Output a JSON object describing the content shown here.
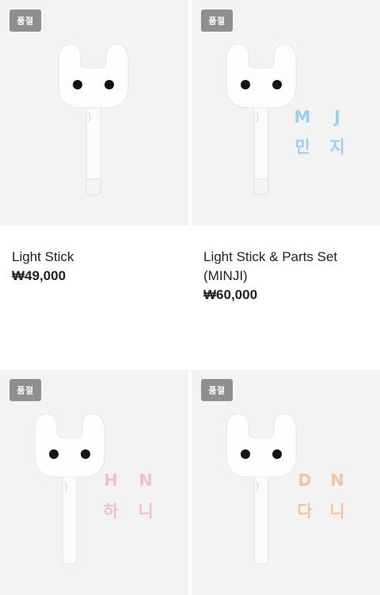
{
  "products": [
    {
      "badge": "품절",
      "name": "Light Stick",
      "price": "₩49,000"
    },
    {
      "badge": "품절",
      "name": "Light Stick & Parts Set (MINJI)",
      "price": "₩60,000",
      "parts": [
        "M",
        "J",
        "민",
        "지"
      ],
      "parts_color": "#9ccff0"
    },
    {
      "badge": "품절",
      "name": "",
      "price": "",
      "parts": [
        "H",
        "N",
        "하",
        "니"
      ],
      "parts_color": "#f3bfcb"
    },
    {
      "badge": "품절",
      "name": "",
      "price": "",
      "parts": [
        "D",
        "N",
        "다",
        "니"
      ],
      "parts_color": "#f6c49d"
    }
  ],
  "icons": {
    "product": "bunny-light-stick-icon"
  }
}
